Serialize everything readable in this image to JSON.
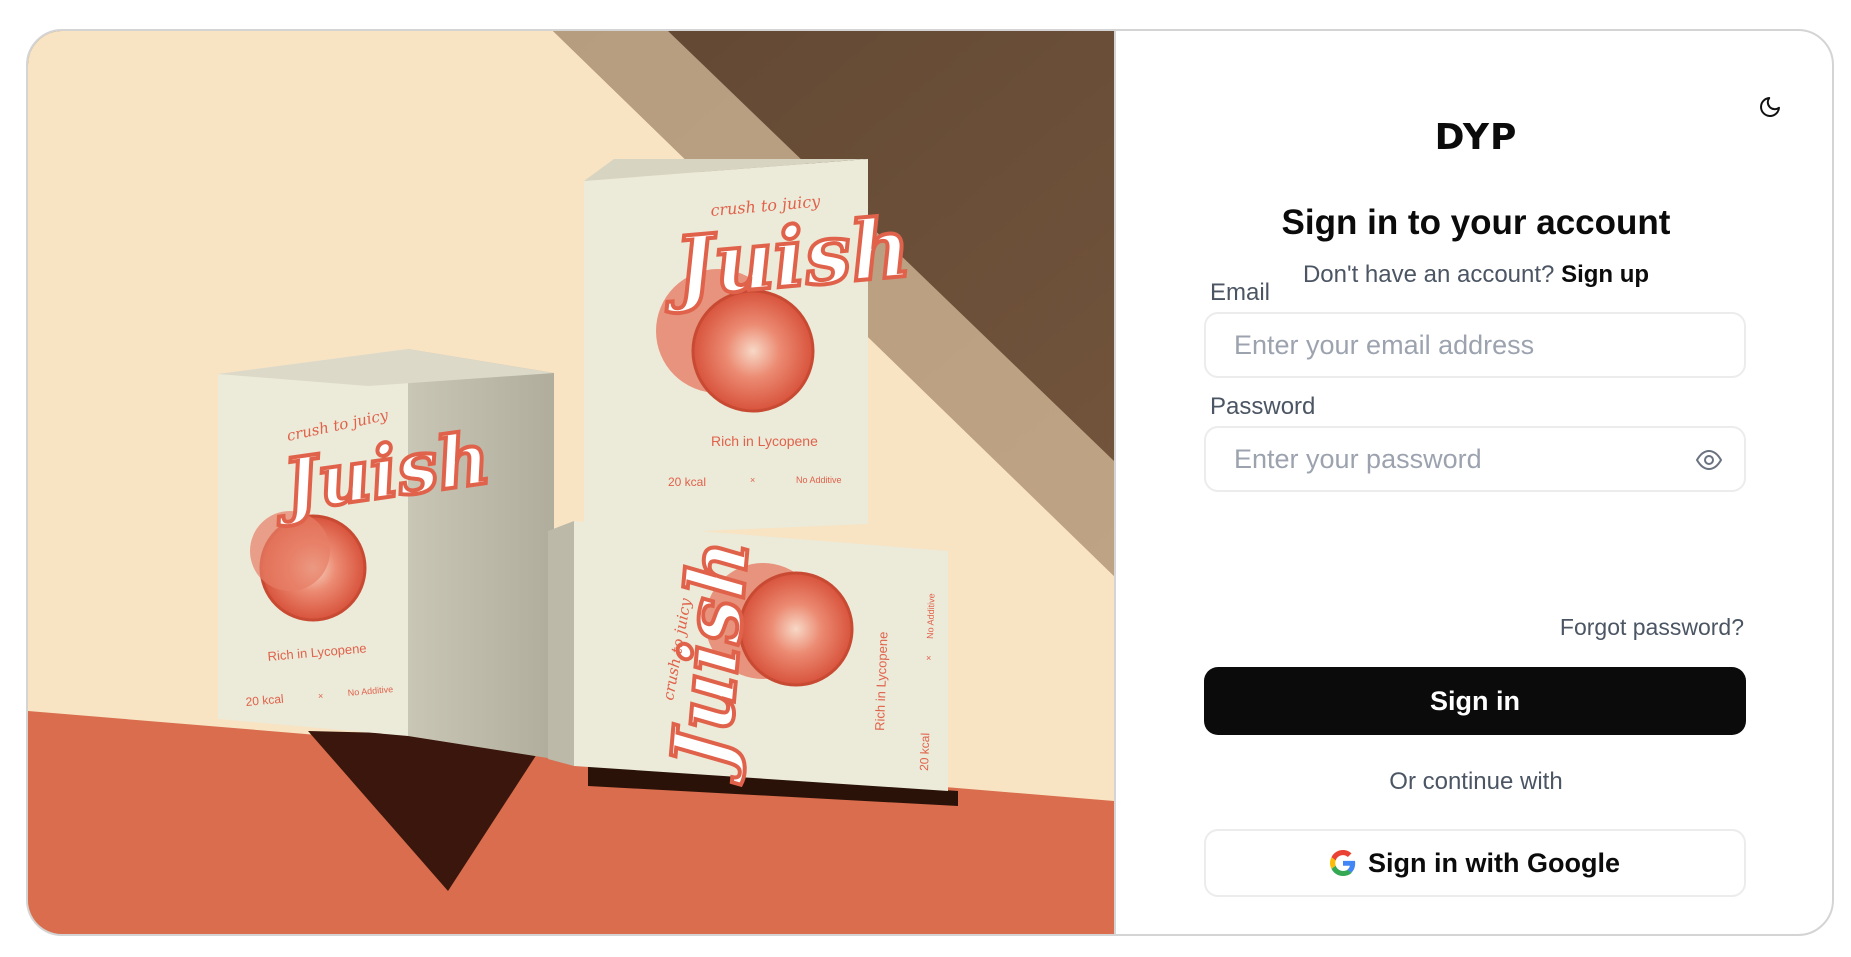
{
  "hero": {
    "box_brand": "Juish",
    "box_tagline": "crush to juicy",
    "box_claim": "Rich in Lycopene",
    "box_kcal": "20 kcal",
    "box_separator": "×",
    "box_additive": "No Additive",
    "colors": {
      "cream": "#f8e3c2",
      "brown": "#6d513a",
      "terracotta": "#d96d4d",
      "box": "#eceadc",
      "red": "#e0624b"
    }
  },
  "panel": {
    "theme_icon": "moon-icon",
    "logo": "DYP",
    "title": "Sign in to your account",
    "subtitle_prefix": "Don't have an account?",
    "signup_link": "Sign up",
    "email_label": "Email",
    "email_placeholder": "Enter your email address",
    "email_value": "",
    "password_label": "Password",
    "password_placeholder": "Enter your password",
    "password_value": "",
    "password_toggle_icon": "eye-icon",
    "forgot_link": "Forgot password?",
    "signin_button": "Sign in",
    "divider": "Or continue with",
    "google_button": "Sign in with Google",
    "google_icon": "google-icon",
    "accent": "#0b0b0b"
  }
}
